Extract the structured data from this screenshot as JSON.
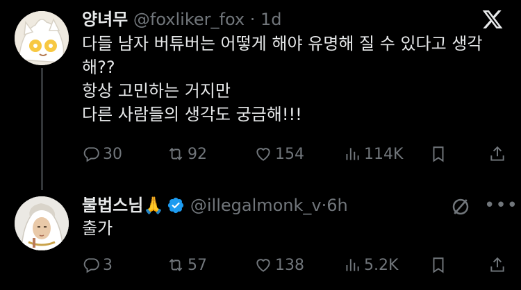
{
  "tweets": [
    {
      "display_name": "양녀무",
      "handle": "@foxliker_fox",
      "separator": " · ",
      "time": "1d",
      "text_lines": [
        "다들 남자 버튜버는 어떻게 해야 유명해 질 수 있다고 생각",
        "해??",
        "항상 고민하는 거지만",
        "다른 사람들의 생각도 궁금해!!!"
      ],
      "stats": {
        "replies": "30",
        "reposts": "92",
        "likes": "154",
        "views": "114K"
      }
    },
    {
      "display_name": "불법스님",
      "emoji": "🙏",
      "handle": "@illegalmonk_v",
      "separator": "·",
      "time": "6h",
      "text_lines": [
        "출가"
      ],
      "more_label": "•••",
      "stats": {
        "replies": "3",
        "reposts": "57",
        "likes": "138",
        "views": "5.2K"
      }
    }
  ],
  "icons": {
    "logo": "x-logo-icon",
    "verified_color": "#1d9bf0"
  },
  "colors": {
    "background": "#000000",
    "text": "#e7e9ea",
    "muted": "#71767b",
    "verified": "#1d9bf0"
  }
}
